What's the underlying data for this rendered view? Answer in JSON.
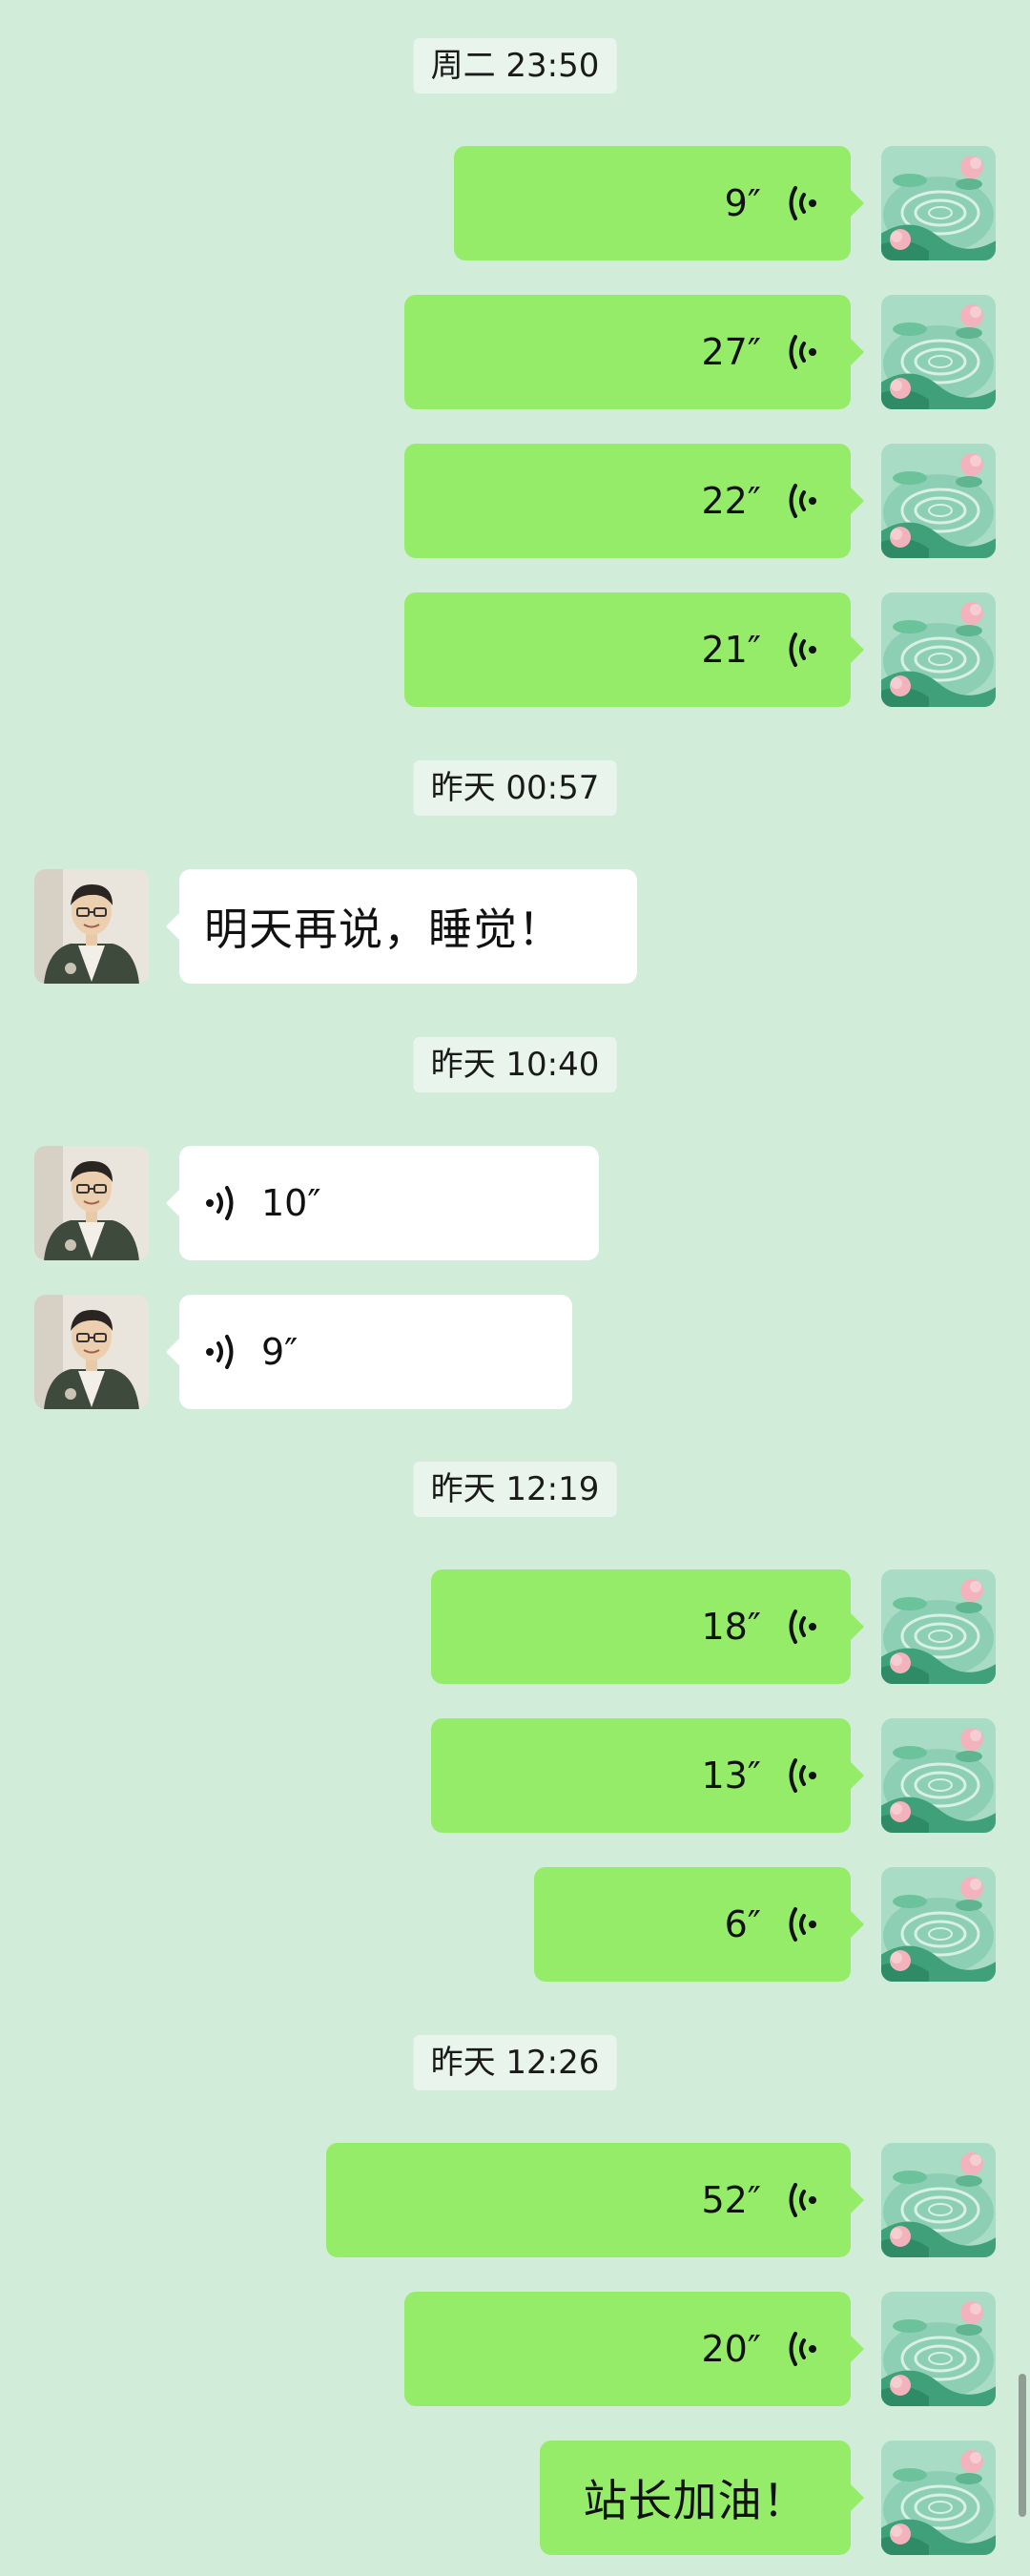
{
  "colors": {
    "background": "#d1ecd9",
    "outgoing_bubble": "#95ec69",
    "incoming_bubble": "#ffffff",
    "timestamp_bg": "#e9f5ec"
  },
  "messages": [
    {
      "kind": "time",
      "text": "周二 23:50"
    },
    {
      "kind": "voice",
      "dir": "out",
      "duration": "9″"
    },
    {
      "kind": "voice",
      "dir": "out",
      "duration": "27″"
    },
    {
      "kind": "voice",
      "dir": "out",
      "duration": "22″"
    },
    {
      "kind": "voice",
      "dir": "out",
      "duration": "21″"
    },
    {
      "kind": "time",
      "text": "昨天 00:57"
    },
    {
      "kind": "text",
      "dir": "in",
      "text": "明天再说，睡觉！"
    },
    {
      "kind": "time",
      "text": "昨天 10:40"
    },
    {
      "kind": "voice",
      "dir": "in",
      "duration": "10″"
    },
    {
      "kind": "voice",
      "dir": "in",
      "duration": "9″"
    },
    {
      "kind": "time",
      "text": "昨天 12:19"
    },
    {
      "kind": "voice",
      "dir": "out",
      "duration": "18″"
    },
    {
      "kind": "voice",
      "dir": "out",
      "duration": "13″"
    },
    {
      "kind": "voice",
      "dir": "out",
      "duration": "6″"
    },
    {
      "kind": "time",
      "text": "昨天 12:26"
    },
    {
      "kind": "voice",
      "dir": "out",
      "duration": "52″"
    },
    {
      "kind": "voice",
      "dir": "out",
      "duration": "20″"
    },
    {
      "kind": "text",
      "dir": "out",
      "text": "站长加油！"
    }
  ],
  "icons": {
    "voice": "voice-wave-icon",
    "my_avatar": "lotus-pond-avatar",
    "contact_avatar": "person-photo-avatar"
  }
}
